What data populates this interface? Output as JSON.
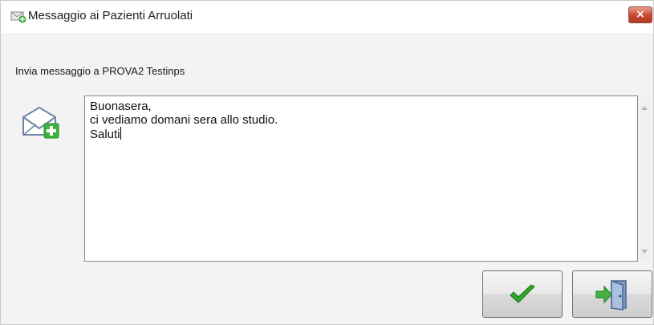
{
  "window": {
    "title": "Messaggio ai Pazienti Arruolati",
    "title_icon": "envelope-add-icon",
    "close_label": "×"
  },
  "recipient": {
    "label": "Invia messaggio a PROVA2 Testinps"
  },
  "envelope_icon": "envelope-add-icon",
  "message": {
    "text": "Buonasera,\nci vediamo domani sera allo studio.\nSaluti"
  },
  "buttons": {
    "ok_icon": "checkmark-icon",
    "exit_icon": "exit-door-icon"
  },
  "colors": {
    "ok_check": "#2fa52f",
    "exit_arrow": "#45b045",
    "close_button": "#c7452d"
  }
}
